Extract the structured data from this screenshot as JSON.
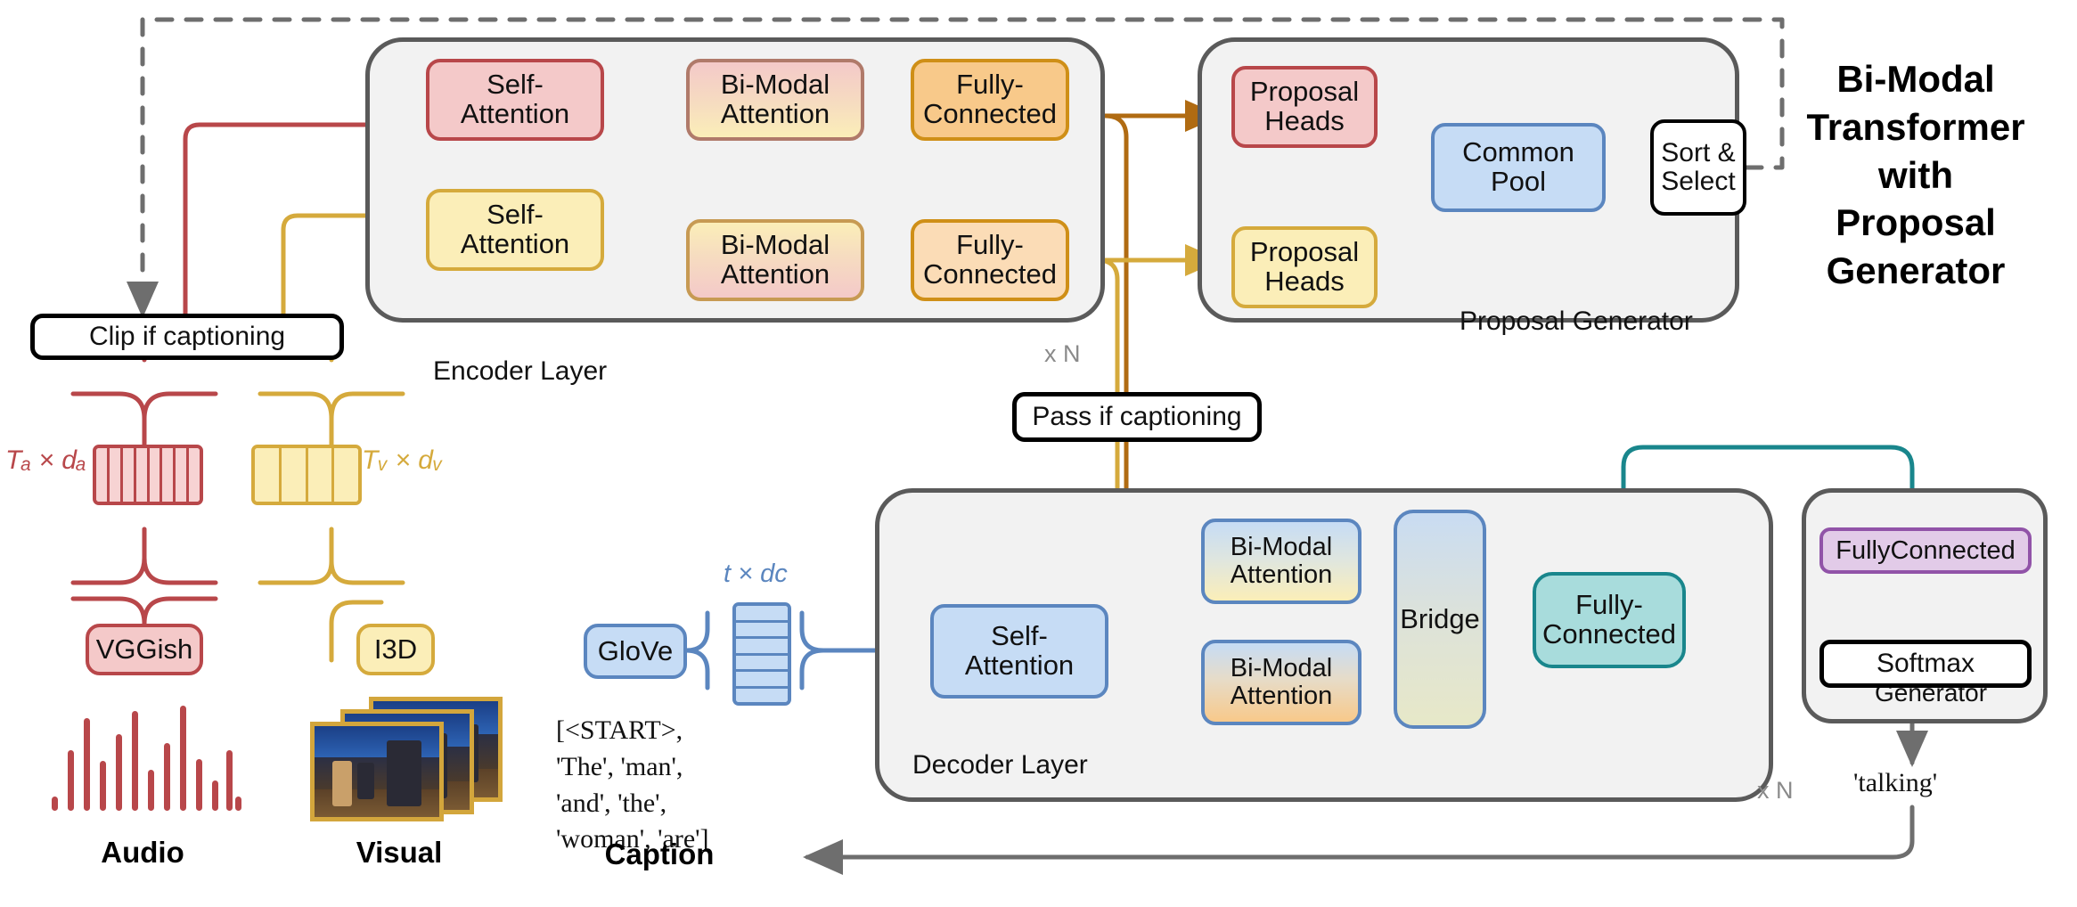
{
  "title": {
    "lines": [
      "Bi-Modal",
      "Transformer",
      "with",
      "Proposal",
      "Generator"
    ]
  },
  "gates": {
    "clip": "Clip if captioning",
    "pass": "Pass if captioning"
  },
  "encoder": {
    "caption": "Encoder Layer",
    "repeat": "x N",
    "audio": {
      "self_attention": "Self-\nAttention",
      "bimodal_attention": "Bi-Modal\nAttention",
      "fully_connected": "Fully-\nConnected"
    },
    "visual": {
      "self_attention": "Self-\nAttention",
      "bimodal_attention": "Bi-Modal\nAttention",
      "fully_connected": "Fully-\nConnected"
    }
  },
  "proposal_generator": {
    "caption": "Proposal Generator",
    "audio_heads": "Proposal\nHeads",
    "visual_heads": "Proposal\nHeads",
    "common_pool": "Common\nPool",
    "sort_select": "Sort &\nSelect"
  },
  "decoder": {
    "caption": "Decoder Layer",
    "repeat": "x N",
    "self_attention": "Self-\nAttention",
    "bimodal_attention_top": "Bi-Modal\nAttention",
    "bimodal_attention_bottom": "Bi-Modal\nAttention",
    "bridge": "Bridge",
    "fully_connected": "Fully-\nConnected"
  },
  "generator": {
    "caption": "Generator",
    "fully_connected": "FullyConnected",
    "softmax": "Softmax",
    "output_token": "'talking'"
  },
  "inputs": {
    "audio": {
      "extractor": "VGGish",
      "dim_label": "Tₐ × dₐ",
      "modality_label": "Audio",
      "token_count": 8
    },
    "visual": {
      "extractor": "I3D",
      "dim_label": "Tᵥ × dᵥ",
      "modality_label": "Visual",
      "token_count": 4
    },
    "caption": {
      "extractor": "GloVe",
      "dim_label": "t × dᴄ",
      "modality_label": "Caption",
      "tokens_text": "[<START>,\n'The', 'man',\n'and', 'the',\n'woman', 'are']",
      "token_count": 6
    }
  },
  "colors": {
    "audio": "#b8474a",
    "visual": "#d5aa3c",
    "caption": "#5b86bf",
    "audio_fc": "#b06b12",
    "visual_fc": "#d5aa3c",
    "decoder_fc": "#19868c",
    "generator_fc": "#9153a8",
    "gray": "#5a5a5a",
    "panel_fill": "#f2f2f2"
  }
}
